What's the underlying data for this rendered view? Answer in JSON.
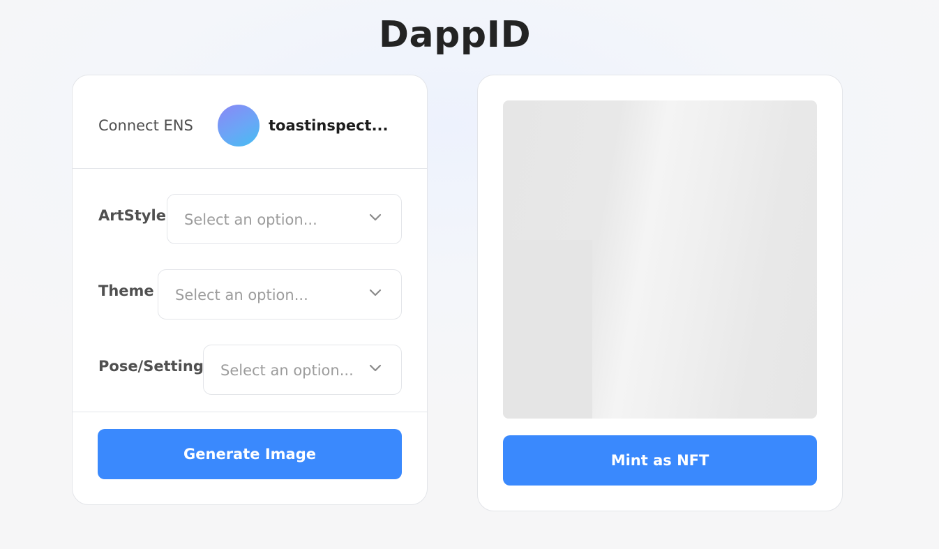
{
  "app": {
    "title": "DappID"
  },
  "identity_panel": {
    "connect_label": "Connect ENS",
    "ens_name": "toastinspect..."
  },
  "form": {
    "fields": [
      {
        "label": "ArtStyle",
        "placeholder": "Select an option..."
      },
      {
        "label": "Theme",
        "placeholder": "Select an option..."
      },
      {
        "label": "Pose/Setting",
        "placeholder": "Select an option..."
      }
    ],
    "generate_label": "Generate Image"
  },
  "preview_panel": {
    "mint_label": "Mint as NFT"
  },
  "colors": {
    "accent": "#3a89fd",
    "avatar_gradient": [
      "#8b87f5",
      "#45bdf2"
    ]
  }
}
